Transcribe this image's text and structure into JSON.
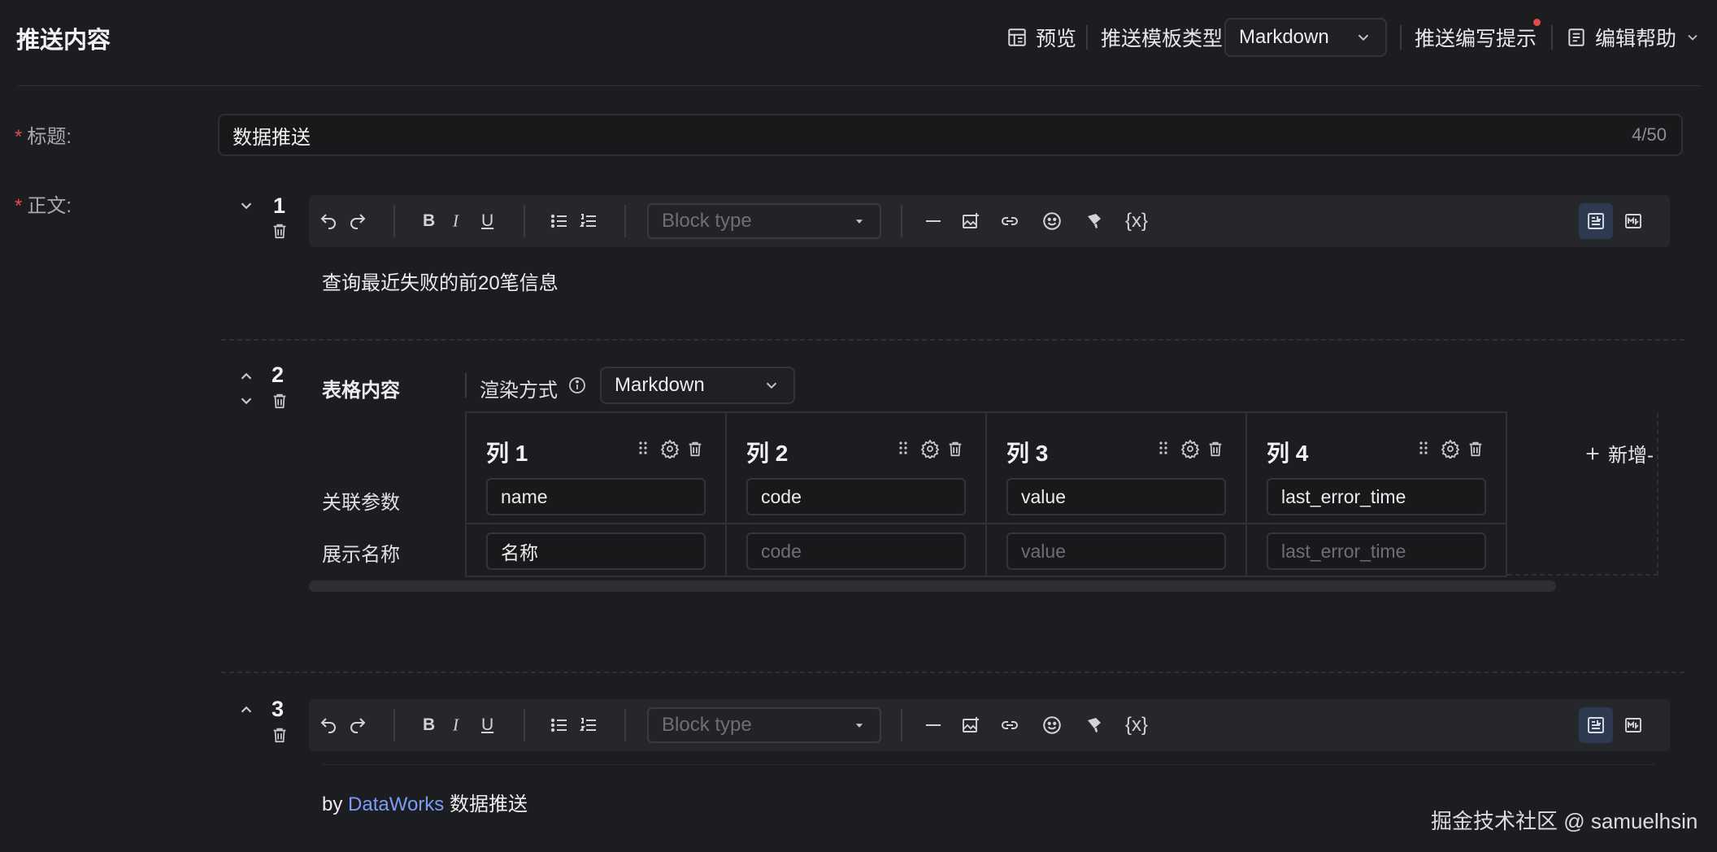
{
  "header": {
    "title": "推送内容",
    "preview_label": "预览",
    "template_type_label": "推送模板类型",
    "template_type_value": "Markdown",
    "writing_tips_label": "推送编写提示",
    "edit_help_label": "编辑帮助"
  },
  "form": {
    "title_label": "标题:",
    "title_value": "数据推送",
    "title_count": "4/50",
    "body_label": "正文:"
  },
  "blocks": [
    {
      "number": "1",
      "block_type_placeholder": "Block type",
      "variable_label": "{x}",
      "content": "查询最近失败的前20笔信息"
    },
    {
      "number": "2",
      "table_label": "表格内容",
      "render_mode_label": "渲染方式",
      "render_mode_value": "Markdown",
      "add_column_label": "新增-",
      "row_labels": [
        "关联参数",
        "展示名称"
      ],
      "columns": [
        {
          "header": "列 1",
          "param": "name",
          "display": "名称",
          "display_placeholder": ""
        },
        {
          "header": "列 2",
          "param": "code",
          "display": "",
          "display_placeholder": "code"
        },
        {
          "header": "列 3",
          "param": "value",
          "display": "",
          "display_placeholder": "value"
        },
        {
          "header": "列 4",
          "param": "last_error_time",
          "display": "",
          "display_placeholder": "last_error_time"
        }
      ]
    },
    {
      "number": "3",
      "block_type_placeholder": "Block type",
      "variable_label": "{x}",
      "content_prefix": "by",
      "content_link": "DataWorks",
      "content_suffix": "数据推送"
    }
  ],
  "watermark": "掘金技术社区 @ samuelhsin",
  "colors": {
    "background": "#1c1d20",
    "required_star": "#e34b4b",
    "link": "#7b9cf5",
    "active_mode": "#2e3a52"
  }
}
